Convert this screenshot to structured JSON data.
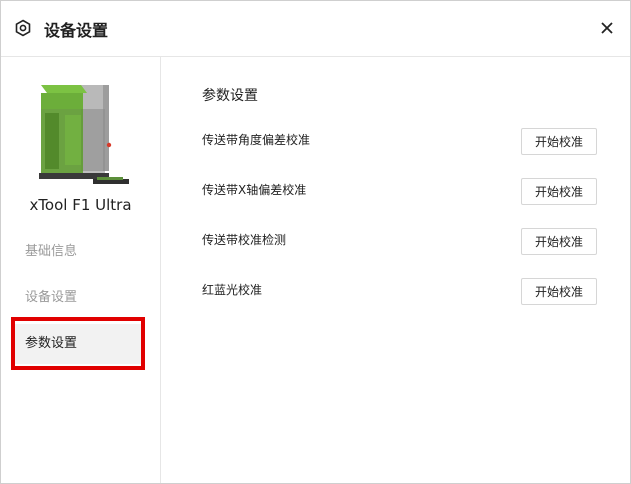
{
  "window": {
    "title": "设备设置",
    "title_icon": "settings-hexagon-icon",
    "close_icon": "close-icon"
  },
  "sidebar": {
    "device_name": "xTool F1 Ultra",
    "device_image": "laser-machine-image",
    "items": [
      {
        "label": "基础信息",
        "active": false
      },
      {
        "label": "设备设置",
        "active": false
      },
      {
        "label": "参数设置",
        "active": true
      }
    ]
  },
  "main": {
    "section_title": "参数设置",
    "rows": [
      {
        "label": "传送带角度偏差校准",
        "button": "开始校准"
      },
      {
        "label": "传送带X轴偏差校准",
        "button": "开始校准"
      },
      {
        "label": "传送带校准检测",
        "button": "开始校准"
      },
      {
        "label": "红蓝光校准",
        "button": "开始校准"
      }
    ]
  },
  "colors": {
    "accent_highlight": "#e10000",
    "active_bg": "#f2f2f2",
    "machine_green": "#6cae3a"
  }
}
